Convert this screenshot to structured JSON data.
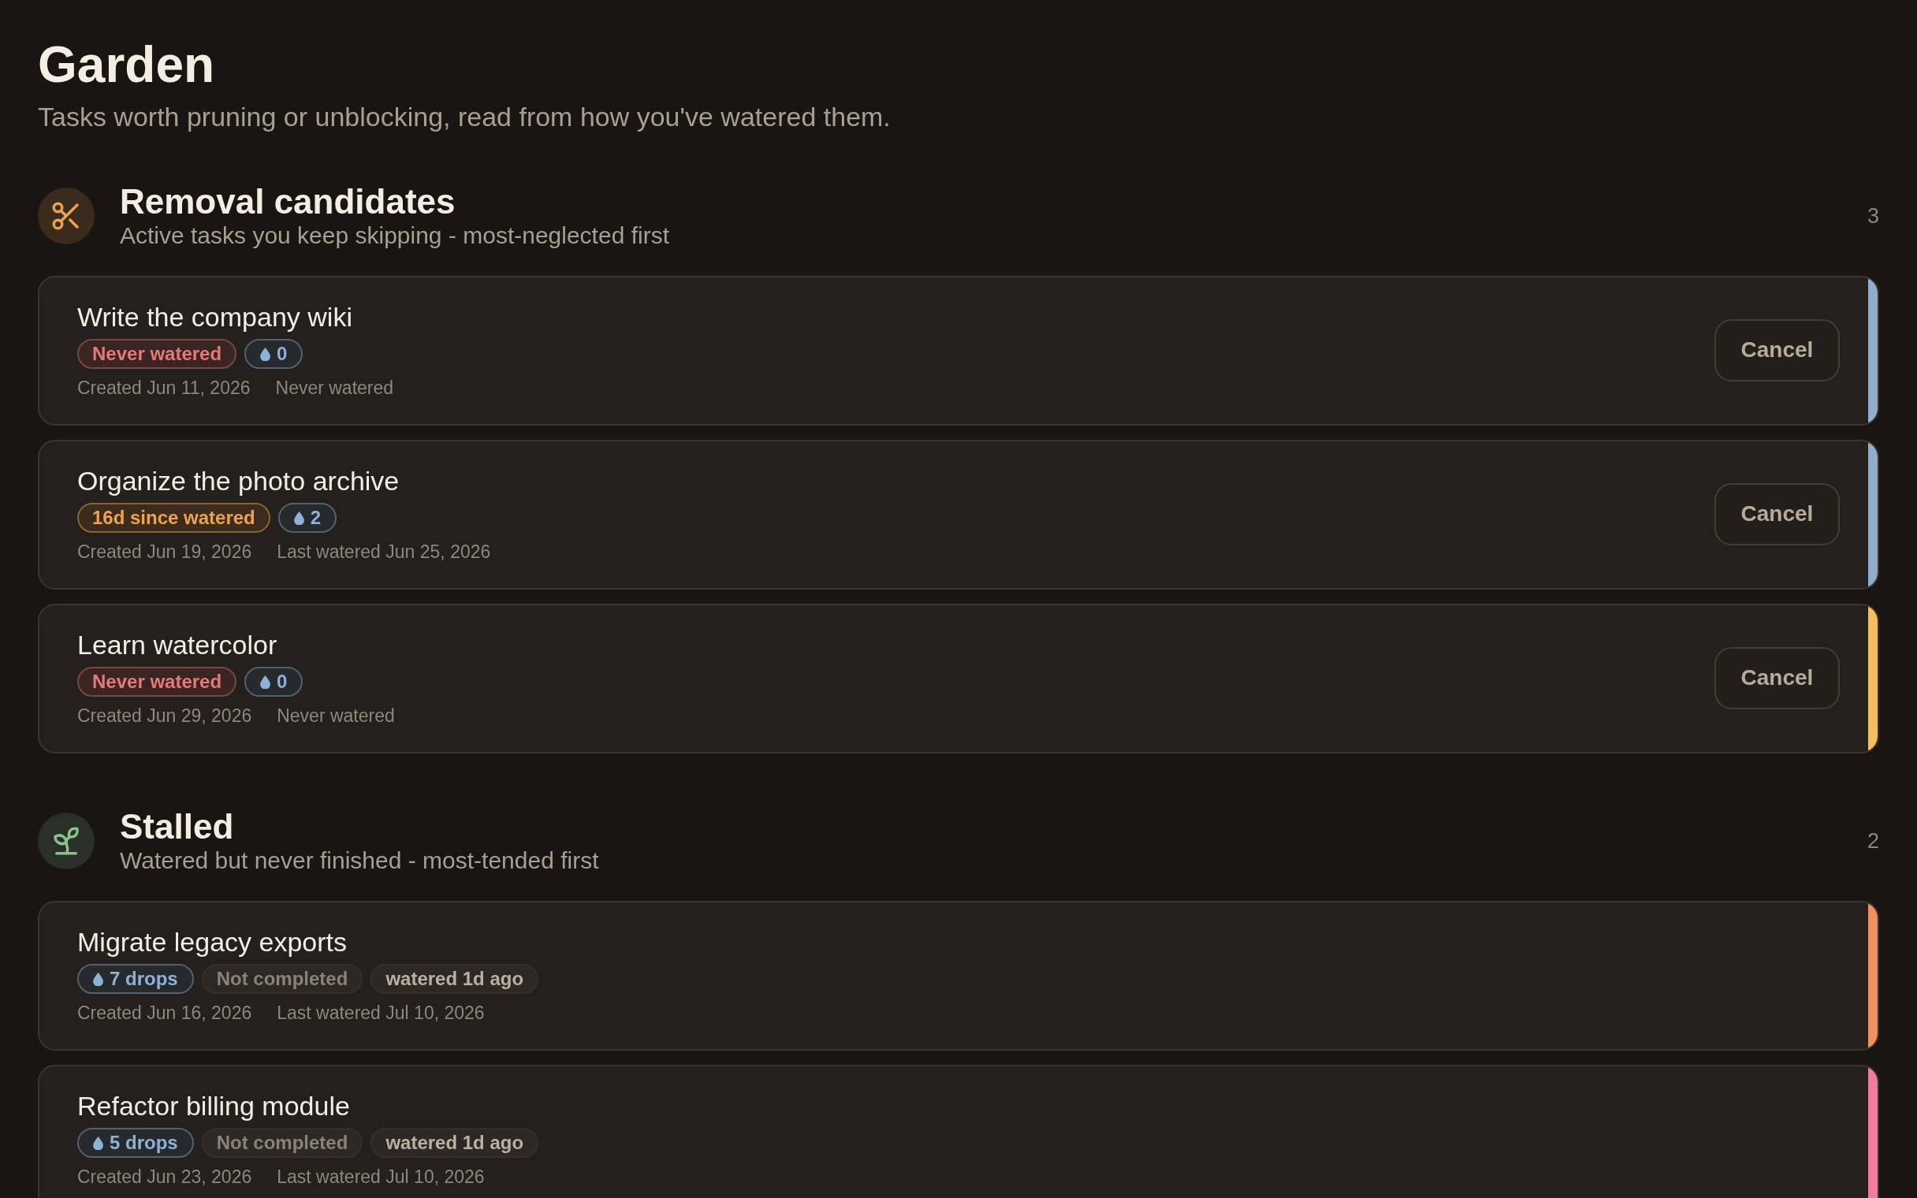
{
  "title": "Garden",
  "subtitle": "Tasks worth pruning or unblocking, read from how you've watered them.",
  "sections": [
    {
      "kind": "removal",
      "title": "Removal candidates",
      "description": "Active tasks you keep skipping - most-neglected first",
      "count": "3",
      "tasks": [
        {
          "title": "Write the company wiki",
          "color": "#91aecb",
          "badges": [
            {
              "kind": "never",
              "text": "Never watered"
            },
            {
              "kind": "drops",
              "text": "0"
            }
          ],
          "meta": [
            "Created Jun 11, 2026",
            "Never watered"
          ],
          "action": "Cancel"
        },
        {
          "title": "Organize the photo archive",
          "color": "#91aecb",
          "badges": [
            {
              "kind": "since",
              "text": "16d since watered"
            },
            {
              "kind": "drops",
              "text": "2"
            }
          ],
          "meta": [
            "Created Jun 19, 2026",
            "Last watered Jun 25, 2026"
          ],
          "action": "Cancel"
        },
        {
          "title": "Learn watercolor",
          "color": "#f2be5f",
          "badges": [
            {
              "kind": "never",
              "text": "Never watered"
            },
            {
              "kind": "drops",
              "text": "0"
            }
          ],
          "meta": [
            "Created Jun 29, 2026",
            "Never watered"
          ],
          "action": "Cancel"
        }
      ]
    },
    {
      "kind": "stalled",
      "title": "Stalled",
      "description": "Watered but never finished - most-tended first",
      "count": "2",
      "tasks": [
        {
          "title": "Migrate legacy exports",
          "color": "#ef9162",
          "badges": [
            {
              "kind": "drops",
              "text": "7 drops"
            },
            {
              "kind": "status",
              "text": "Not completed"
            },
            {
              "kind": "recency",
              "text": "watered 1d ago"
            }
          ],
          "meta": [
            "Created Jun 16, 2026",
            "Last watered Jul 10, 2026"
          ]
        },
        {
          "title": "Refactor billing module",
          "color": "#f27ba3",
          "badges": [
            {
              "kind": "drops",
              "text": "5 drops"
            },
            {
              "kind": "status",
              "text": "Not completed"
            },
            {
              "kind": "recency",
              "text": "watered 1d ago"
            }
          ],
          "meta": [
            "Created Jun 23, 2026",
            "Last watered Jul 10, 2026"
          ]
        }
      ]
    }
  ]
}
